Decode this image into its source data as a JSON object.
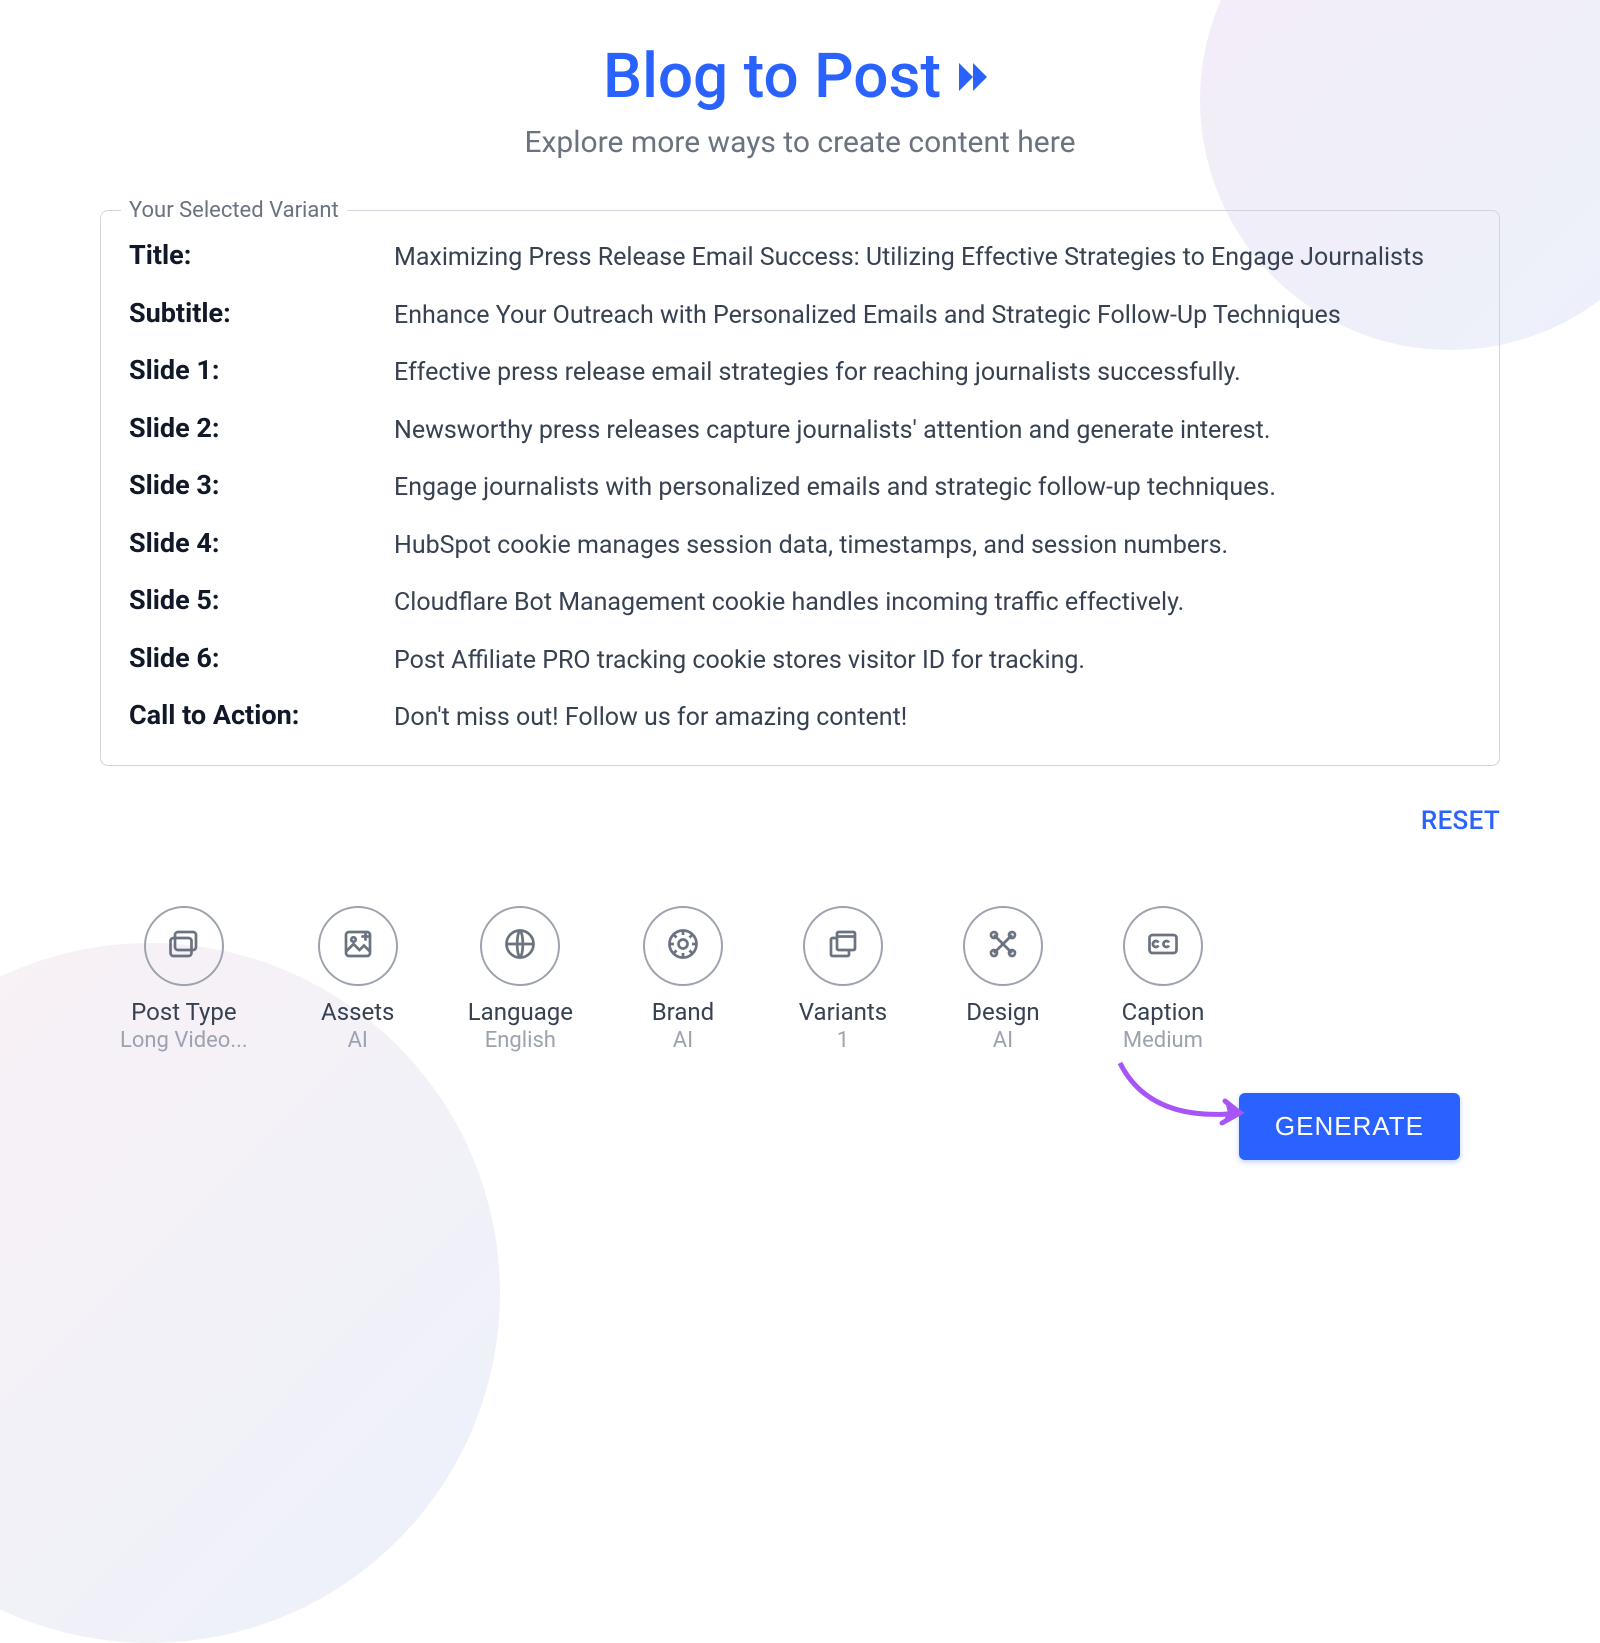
{
  "header": {
    "title": "Blog to Post",
    "subtitle": "Explore more ways to create content here"
  },
  "variant": {
    "legend": "Your Selected Variant",
    "rows": [
      {
        "label": "Title:",
        "value": "Maximizing Press Release Email Success: Utilizing Effective Strategies to Engage Journalists"
      },
      {
        "label": "Subtitle:",
        "value": "Enhance Your Outreach with Personalized Emails and Strategic Follow-Up Techniques"
      },
      {
        "label": "Slide 1:",
        "value": "Effective press release email strategies for reaching journalists successfully."
      },
      {
        "label": "Slide 2:",
        "value": "Newsworthy press releases capture journalists' attention and generate interest."
      },
      {
        "label": "Slide 3:",
        "value": "Engage journalists with personalized emails and strategic follow-up techniques."
      },
      {
        "label": "Slide 4:",
        "value": "HubSpot cookie manages session data, timestamps, and session numbers."
      },
      {
        "label": "Slide 5:",
        "value": "Cloudflare Bot Management cookie handles incoming traffic effectively."
      },
      {
        "label": "Slide 6:",
        "value": "Post Affiliate PRO tracking cookie stores visitor ID for tracking."
      },
      {
        "label": "Call to Action:",
        "value": "Don't miss out! Follow us for amazing content!"
      }
    ]
  },
  "reset_label": "RESET",
  "options": [
    {
      "icon": "post-type-icon",
      "label": "Post Type",
      "value": "Long Video..."
    },
    {
      "icon": "assets-icon",
      "label": "Assets",
      "value": "AI"
    },
    {
      "icon": "language-icon",
      "label": "Language",
      "value": "English"
    },
    {
      "icon": "brand-icon",
      "label": "Brand",
      "value": "AI"
    },
    {
      "icon": "variants-icon",
      "label": "Variants",
      "value": "1"
    },
    {
      "icon": "design-icon",
      "label": "Design",
      "value": "AI"
    },
    {
      "icon": "caption-icon",
      "label": "Caption",
      "value": "Medium"
    }
  ],
  "generate_label": "GENERATE"
}
